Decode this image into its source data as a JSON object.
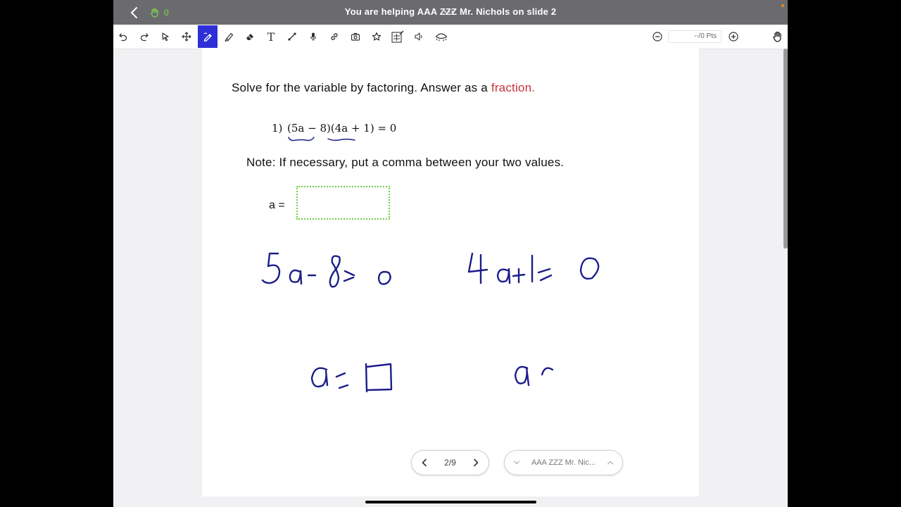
{
  "window": {
    "title": "You are helping AAA ZZZ Mr. Nichols on slide 2",
    "raised_hands_count": "0"
  },
  "toolbar": {
    "tools": [
      {
        "name": "undo-icon"
      },
      {
        "name": "redo-icon"
      },
      {
        "name": "select-arrow-icon"
      },
      {
        "name": "move-icon"
      },
      {
        "name": "pen-icon",
        "active": true
      },
      {
        "name": "highlighter-icon"
      },
      {
        "name": "eraser-icon"
      },
      {
        "name": "text-icon",
        "glyph": "T"
      },
      {
        "name": "line-icon"
      },
      {
        "name": "microphone-icon"
      },
      {
        "name": "link-icon"
      },
      {
        "name": "camera-icon"
      },
      {
        "name": "star-icon"
      },
      {
        "name": "math-tools-icon"
      },
      {
        "name": "speaker-icon"
      },
      {
        "name": "hide-eye-icon"
      }
    ],
    "points_value": "--/0 Pts"
  },
  "slide": {
    "instruction_text": "Solve for the variable by factoring. Answer as a",
    "instruction_highlight": "fraction.",
    "problem_number": "1)",
    "equation": "(5a − 8)(4a + 1) = 0",
    "note": "Note: If necessary, put a comma between your two values.",
    "answer_label": "a =",
    "answer_value": ""
  },
  "pager": {
    "current_page": "2/9"
  },
  "student_selector": {
    "label": "AAA ZZZ Mr. Nic..."
  },
  "colors": {
    "active_tool": "#2f2fd8",
    "highlight_text": "#c8323a",
    "answer_box_border": "#6ccf3f",
    "ink": "#1c1d8a",
    "topbar": "#6b6b6f"
  }
}
